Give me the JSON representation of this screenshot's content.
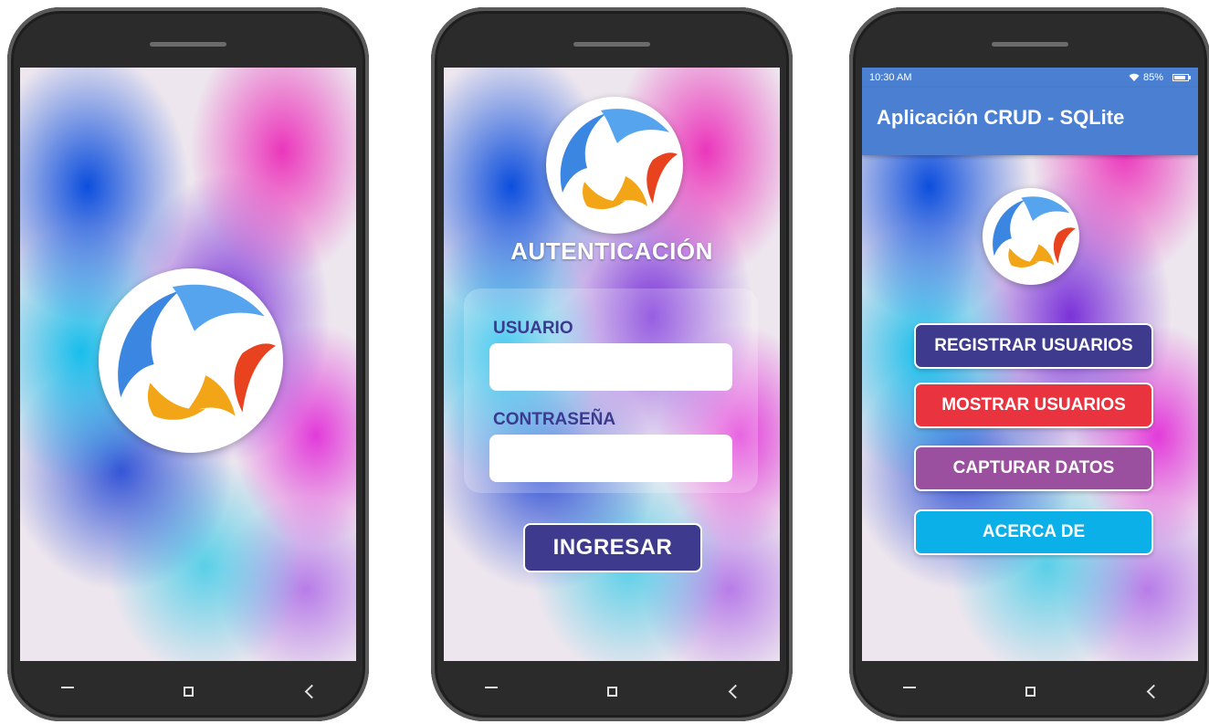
{
  "colors": {
    "phone_body": "#2b2b2b",
    "app_bar": "#4a7fd1",
    "button_dark_blue": "#3e3b8e",
    "button_red": "#e9343f",
    "button_purple": "#9a4f9f",
    "button_cyan": "#0bb0e8",
    "logo_blue": "#3a86e0",
    "logo_orange": "#f2a516",
    "logo_red": "#e8421e",
    "label_color": "#3b3a8f"
  },
  "icons": {
    "logo": "swirl-logo-icon",
    "nav": [
      "minus-icon",
      "square-icon",
      "chevron-left-icon"
    ],
    "status": [
      "wifi-icon",
      "battery-icon"
    ]
  },
  "login": {
    "title": "AUTENTICACIÓN",
    "user_label": "USUARIO",
    "user_value": "",
    "password_label": "CONTRASEÑA",
    "password_value": "",
    "submit_label": "INGRESAR"
  },
  "home": {
    "status_time": "10:30 AM",
    "battery": "85%",
    "app_title": "Aplicación CRUD - SQLite",
    "buttons": [
      "REGISTRAR USUARIOS",
      "MOSTRAR USUARIOS",
      "CAPTURAR DATOS",
      "ACERCA DE"
    ]
  }
}
